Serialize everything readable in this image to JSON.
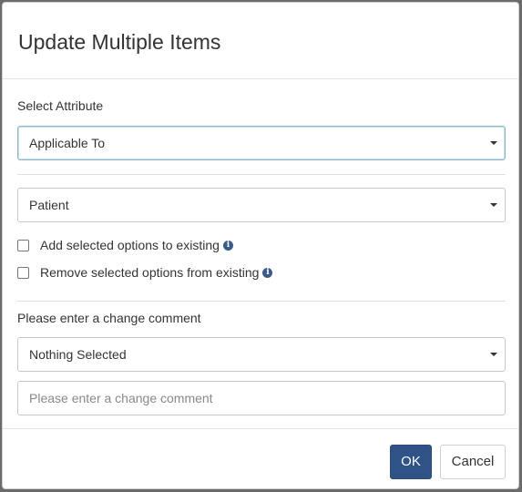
{
  "dialog": {
    "title": "Update Multiple Items",
    "select_attribute_label": "Select Attribute",
    "attribute_select_value": "Applicable To",
    "value_select_value": "Patient",
    "add_option_label": "Add selected options to existing",
    "remove_option_label": "Remove selected options from existing",
    "comment_label": "Please enter a change comment",
    "comment_select_value": "Nothing Selected",
    "comment_input_placeholder": "Please enter a change comment",
    "ok_label": "OK",
    "cancel_label": "Cancel"
  },
  "colors": {
    "primary": "#2f5287",
    "info_icon": "#3a5a8a",
    "focus_border": "#8fb6c8"
  }
}
